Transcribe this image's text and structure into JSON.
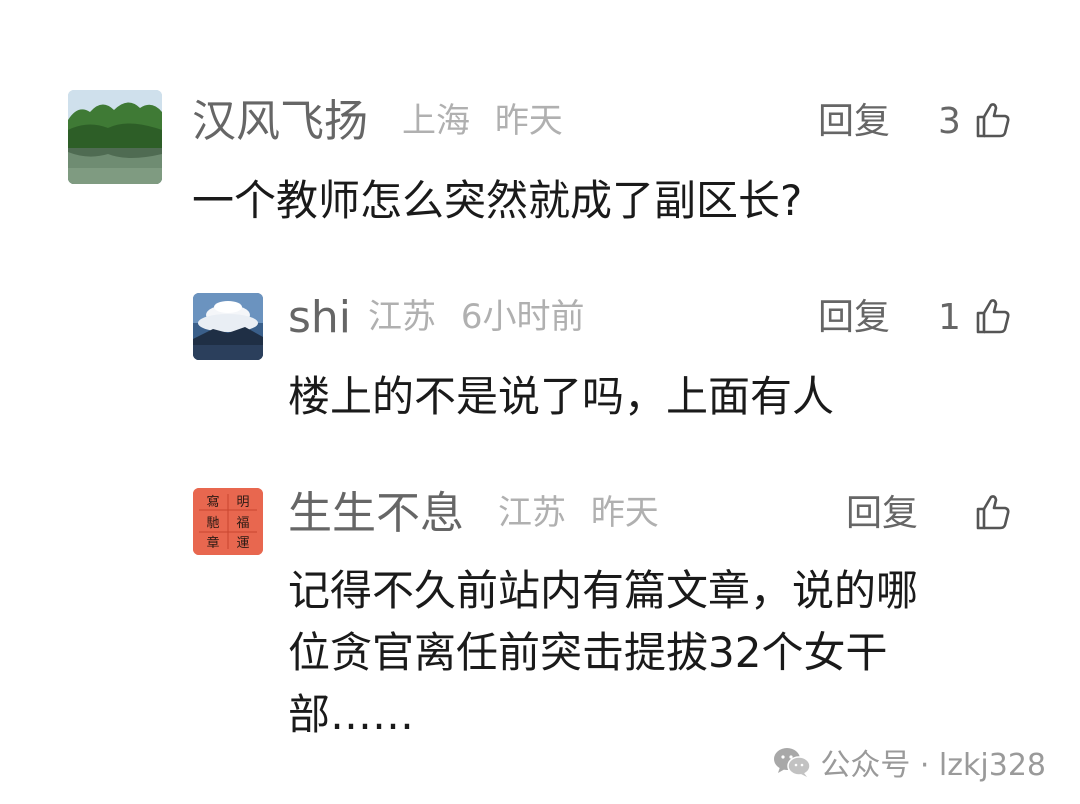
{
  "comments": [
    {
      "name": "汉风飞扬",
      "location": "上海",
      "time": "昨天",
      "reply_label": "回复",
      "likes": "3",
      "text": "一个教师怎么突然就成了副区长?"
    },
    {
      "name": "shi",
      "location": "江苏",
      "time": "6小时前",
      "reply_label": "回复",
      "likes": "1",
      "text": "楼上的不是说了吗，上面有人"
    },
    {
      "name": "生生不息",
      "location": "江苏",
      "time": "昨天",
      "reply_label": "回复",
      "likes": "",
      "text_lines": [
        "记得不久前站内有篇文章，说的哪",
        "位贪官离任前突击提拔32个女干",
        "部……"
      ]
    }
  ],
  "footer": {
    "account_label": "公众号 · lzkj328"
  },
  "avatar_seal_chars": [
    "寫",
    "明",
    "馳",
    "福",
    "章",
    "運"
  ],
  "colors": {
    "name_gray": "#666666",
    "meta_gray": "#b0b0b0",
    "text_black": "#1a1a1a"
  },
  "icons": [
    "thumb-up-icon",
    "wechat-icon"
  ]
}
